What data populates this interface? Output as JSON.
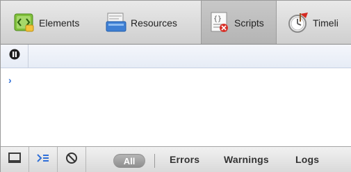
{
  "toolbar": {
    "tabs": [
      {
        "label": "Elements",
        "icon": "elements-icon",
        "selected": false
      },
      {
        "label": "Resources",
        "icon": "resources-icon",
        "selected": false
      },
      {
        "label": "Scripts",
        "icon": "scripts-icon",
        "selected": true
      },
      {
        "label": "Timeli",
        "icon": "timeline-icon",
        "selected": false
      }
    ]
  },
  "pause_bar": {
    "button_icon": "pause-icon"
  },
  "console": {
    "prompt_symbol": "›"
  },
  "status_bar": {
    "buttons": [
      {
        "icon": "dock-window-icon"
      },
      {
        "icon": "console-toggle-icon"
      },
      {
        "icon": "clear-console-icon"
      }
    ],
    "filters": {
      "all": "All",
      "errors": "Errors",
      "warnings": "Warnings",
      "logs": "Logs"
    }
  },
  "colors": {
    "accent": "#2f6fd8",
    "selected_tab": "#bcbcbc"
  }
}
